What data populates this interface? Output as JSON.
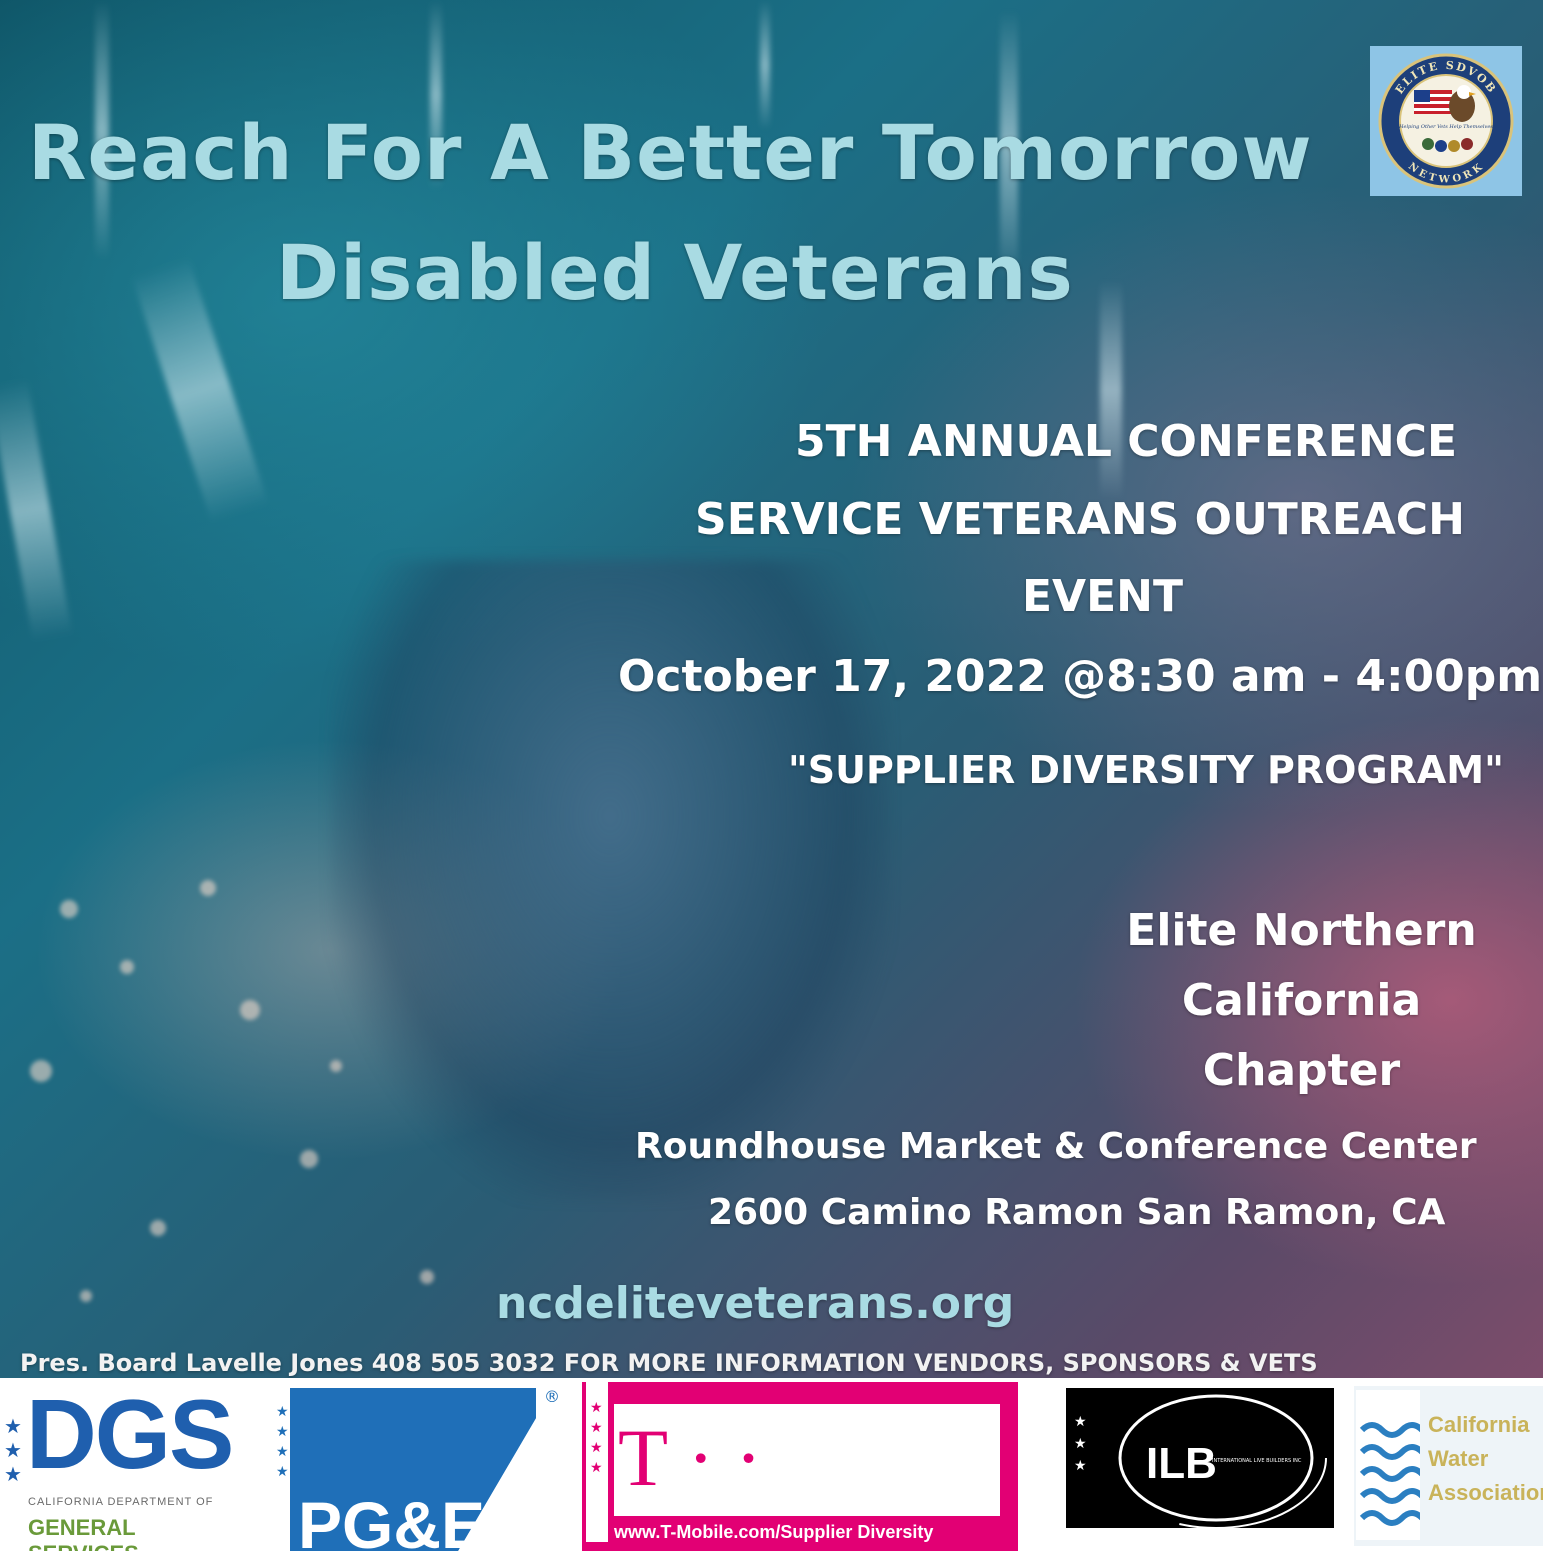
{
  "headline": {
    "line1": "Reach For A Better Tomorrow",
    "line2": "Disabled Veterans"
  },
  "seal": {
    "top_text": "ELITE SDVOB",
    "motto": "\"Helping Other Vets Help Themselves\"",
    "bottom_text": "NETWORK"
  },
  "event": {
    "line1": "5TH ANNUAL CONFERENCE",
    "line2": "SERVICE VETERANS OUTREACH",
    "line3": "EVENT",
    "datetime": "October 17, 2022 @8:30 am - 4:00pm",
    "program": "\"SUPPLIER DIVERSITY PROGRAM\""
  },
  "chapter": {
    "line1": "Elite Northern",
    "line2": "California",
    "line3": "Chapter"
  },
  "venue": {
    "name": "Roundhouse Market & Conference Center",
    "address": "2600 Camino Ramon San Ramon, CA"
  },
  "website": "ncdeliteveterans.org",
  "contact": "Pres. Board Lavelle Jones 408 505 3032 FOR MORE INFORMATION VENDORS, SPONSORS & VETS",
  "sponsors": {
    "dgs": {
      "name": "DGS",
      "caption1": "CALIFORNIA DEPARTMENT OF",
      "caption2": "GENERAL SERVICES"
    },
    "pge": {
      "name": "PG&E",
      "mark": "®"
    },
    "tmobile": {
      "name": "T · · Mobile·",
      "url": "www.T-Mobile.com/Supplier Diversity"
    },
    "ilb": {
      "name": "ILB",
      "sub": "INTERNATIONAL LIVE BUILDERS INC"
    },
    "cwa": {
      "name1": "California",
      "name2": "Water",
      "name3": "Association"
    }
  },
  "colors": {
    "headline": "#a9dbe3",
    "body_text": "#ffffff",
    "dgs_blue": "#1f5fae",
    "dgs_green": "#6a9a3a",
    "pge_blue": "#1f6fb8",
    "tmobile_magenta": "#e20074",
    "cwa_blue": "#2b7fc1"
  }
}
